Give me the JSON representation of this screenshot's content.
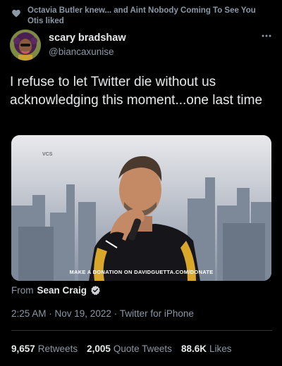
{
  "social_context": {
    "icon": "heart-icon",
    "text": "Octavia Butler knew... and Aint Nobody Coming To See You Otis liked"
  },
  "tweet": {
    "author": {
      "display_name": "scary bradshaw",
      "handle": "@biancaxunise",
      "avatar_icon": "avatar-illustration"
    },
    "more_icon": "more-dots-icon",
    "text": "I refuse to let Twitter die without us acknowledging this moment...one last time",
    "media": {
      "badge": "VCS",
      "caption": "MAKE A DONATION ON DAVIDGUETTA.COM/DONATE"
    },
    "source": {
      "prefix": "From",
      "name": "Sean Craig",
      "icon": "verified-badge-icon"
    },
    "meta": {
      "time": "2:25 AM",
      "separator": " · ",
      "date": "Nov 19, 2022",
      "client": "Twitter for iPhone"
    },
    "stats": [
      {
        "count": "9,657",
        "label": "Retweets"
      },
      {
        "count": "2,005",
        "label": "Quote Tweets"
      },
      {
        "count": "88.6K",
        "label": "Likes"
      }
    ]
  }
}
